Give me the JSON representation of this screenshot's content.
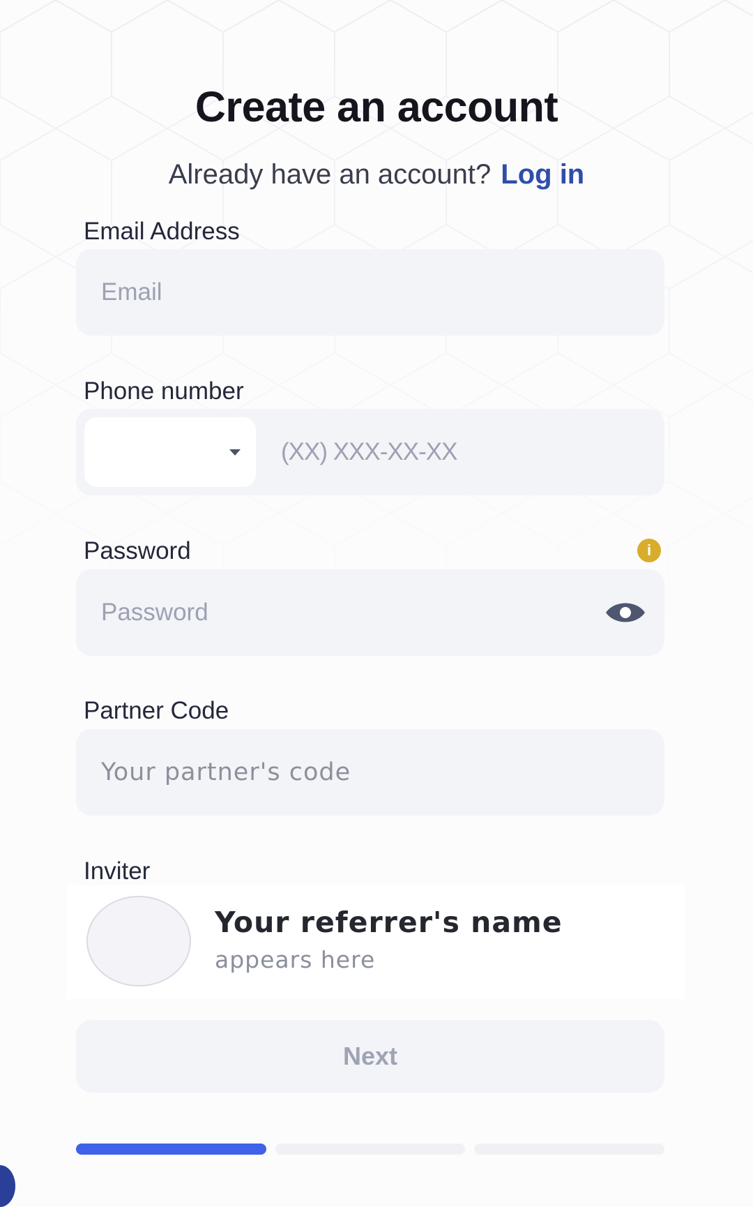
{
  "header": {
    "title": "Create an account",
    "subtitle": "Already have an account?",
    "login_link": "Log in"
  },
  "email": {
    "label": "Email Address",
    "placeholder": "Email"
  },
  "phone": {
    "label": "Phone number",
    "placeholder": "(XX) XXX-XX-XX",
    "country_icon": "chevron-down-icon"
  },
  "password": {
    "label": "Password",
    "placeholder": "Password",
    "info_icon": "info-icon",
    "info_glyph": "i",
    "visibility_icon": "eye-icon"
  },
  "partner": {
    "label": "Partner Code",
    "placeholder": "Your partner's code"
  },
  "inviter": {
    "label": "Inviter",
    "name": "Your referrer's name",
    "sub": "appears here"
  },
  "next_button": "Next",
  "steps": {
    "current": 1,
    "total": 3
  },
  "colors": {
    "accent": "#3f62e8",
    "link": "#2f4ea8",
    "info": "#d8ad2b",
    "field_bg": "#f3f4f7"
  }
}
